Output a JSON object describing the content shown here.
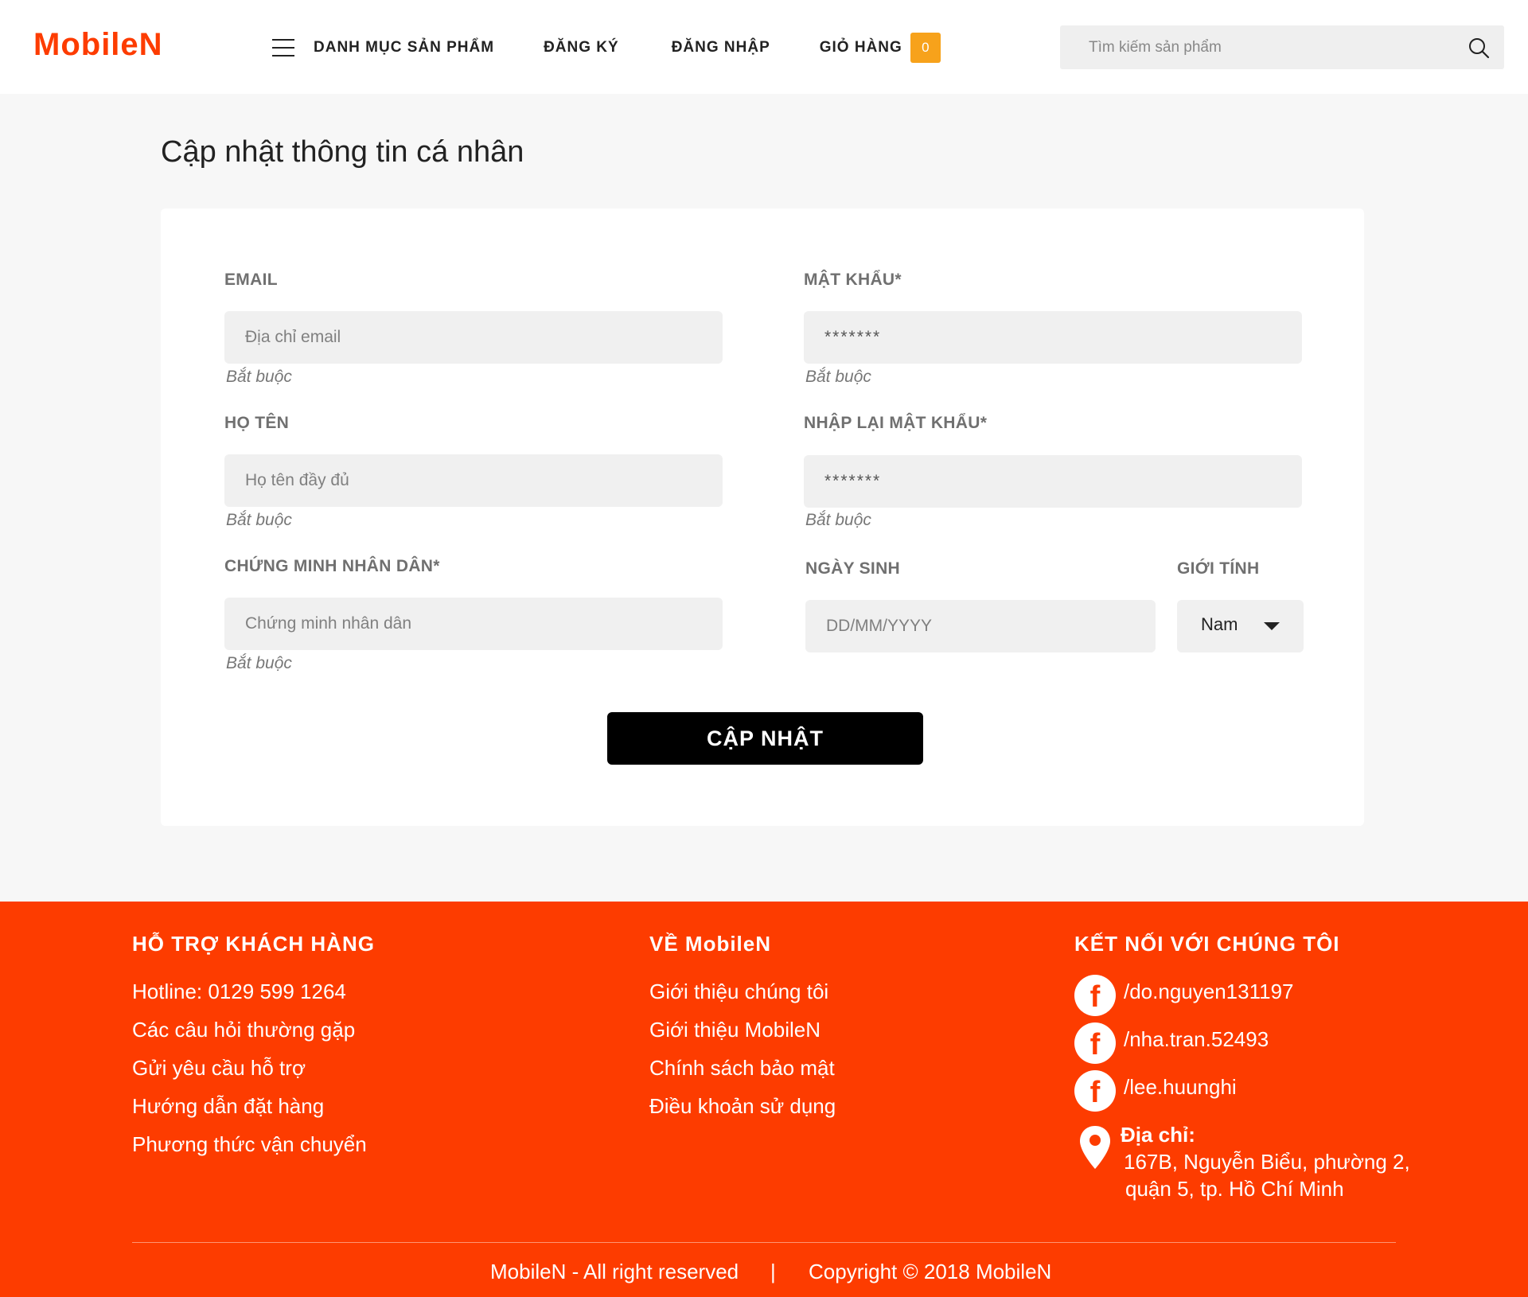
{
  "header": {
    "logo": "MobileN",
    "nav": {
      "categories": "DANH MỤC SẢN PHẨM",
      "register": "ĐĂNG KÝ",
      "login": "ĐĂNG NHẬP",
      "cart": "GIỎ HÀNG",
      "cart_count": "0"
    },
    "search": {
      "placeholder": "Tìm kiếm sản phẩm",
      "value": ""
    },
    "colors": {
      "brand": "#fd3c00",
      "badge": "#f7a21b"
    }
  },
  "main": {
    "title": "Cập nhật thông tin cá nhân",
    "form": {
      "email": {
        "label": "EMAIL",
        "placeholder": "Địa chỉ email",
        "hint": "Bắt buộc"
      },
      "password": {
        "label": "MẬT KHẨU*",
        "placeholder": "*******",
        "hint": "Bắt buộc"
      },
      "fullname": {
        "label": "HỌ TÊN",
        "placeholder": "Họ tên đầy đủ",
        "hint": "Bắt buộc"
      },
      "password_confirm": {
        "label": "NHẬP LẠI MẬT KHẨU*",
        "placeholder": "*******",
        "hint": "Bắt buộc"
      },
      "id_card": {
        "label": "CHỨNG MINH NHÂN DÂN*",
        "placeholder": "Chứng minh nhân dân",
        "hint": "Bắt buộc"
      },
      "dob": {
        "label": "NGÀY SINH",
        "placeholder": "DD/MM/YYYY"
      },
      "gender": {
        "label": "GIỚI TÍNH",
        "value": "Nam"
      },
      "submit": "CẬP NHẬT"
    }
  },
  "footer": {
    "support": {
      "heading": "HỖ TRỢ KHÁCH HÀNG",
      "links": [
        "Hotline: 0129 599 1264",
        "Các câu hỏi thường gặp",
        "Gửi yêu cầu hỗ trợ",
        "Hướng dẫn đặt hàng",
        "Phương thức vận chuyển"
      ]
    },
    "about": {
      "heading": "VỀ MobileN",
      "links": [
        "Giới thiệu chúng tôi",
        "Giới thiệu MobileN",
        "Chính sách bảo mật",
        "Điều khoản sử dụng"
      ]
    },
    "connect": {
      "heading": "KẾT NỐI VỚI CHÚNG TÔI",
      "facebook": [
        "/do.nguyen131197",
        "/nha.tran.52493",
        "/lee.huunghi"
      ],
      "address_label": "Địa chỉ:",
      "address_lines": [
        "167B, Nguyễn Biểu, phường 2,",
        "quận 5, tp. Hồ Chí Minh"
      ]
    },
    "rights": "MobileN - All right reserved",
    "separator": "|",
    "copyright": "Copyright © 2018 MobileN"
  }
}
